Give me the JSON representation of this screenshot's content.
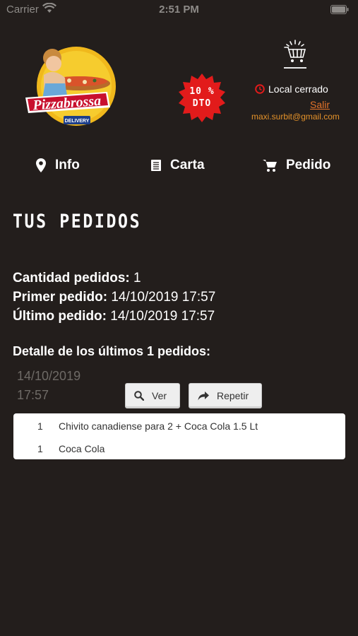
{
  "status_bar": {
    "carrier": "Carrier",
    "time": "2:51 PM"
  },
  "header": {
    "logo_brand": "Pizzabrossa",
    "logo_tagline": "DELIVERY",
    "promo_badge": {
      "line1": "10 %",
      "line2": "DTO",
      "color": "#e21b1b"
    },
    "store_status": "Local cerrado",
    "logout_label": "Salir",
    "user_email": "maxi.surbit@gmail.com"
  },
  "nav": {
    "info_label": "Info",
    "carta_label": "Carta",
    "pedido_label": "Pedido"
  },
  "page_title": "TUS PEDIDOS",
  "summary": {
    "count_label": "Cantidad pedidos:",
    "count_value": "1",
    "first_label": "Primer pedido:",
    "first_value": "14/10/2019 17:57",
    "last_label": "Último pedido:",
    "last_value": "14/10/2019 17:57"
  },
  "detail_heading": "Detalle de los últimos 1 pedidos:",
  "orders": [
    {
      "date": "14/10/2019",
      "time": "17:57",
      "view_label": "Ver",
      "repeat_label": "Repetir",
      "items": [
        {
          "qty": "1",
          "name": "Chivito canadiense para 2 + Coca Cola 1.5 Lt"
        },
        {
          "qty": "1",
          "name": "Coca Cola"
        }
      ]
    }
  ],
  "colors": {
    "background": "#231e1c",
    "accent_orange": "#e4732a",
    "badge_red": "#e21b1b"
  }
}
